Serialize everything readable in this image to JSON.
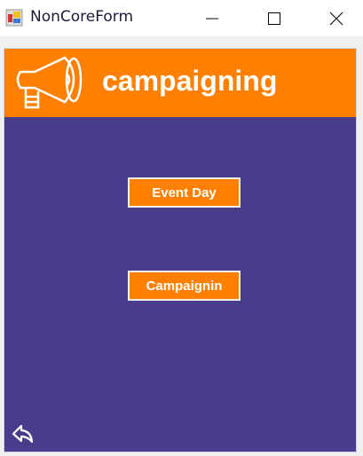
{
  "window": {
    "title": "NonCoreForm"
  },
  "header": {
    "title": "campaigning",
    "icon": "megaphone-icon"
  },
  "buttons": [
    {
      "label": "Event Day"
    },
    {
      "label": "Campaignin"
    }
  ],
  "back": {
    "icon": "back-arrow-icon"
  },
  "colors": {
    "accent": "#ff8000",
    "background": "#483d8b"
  }
}
